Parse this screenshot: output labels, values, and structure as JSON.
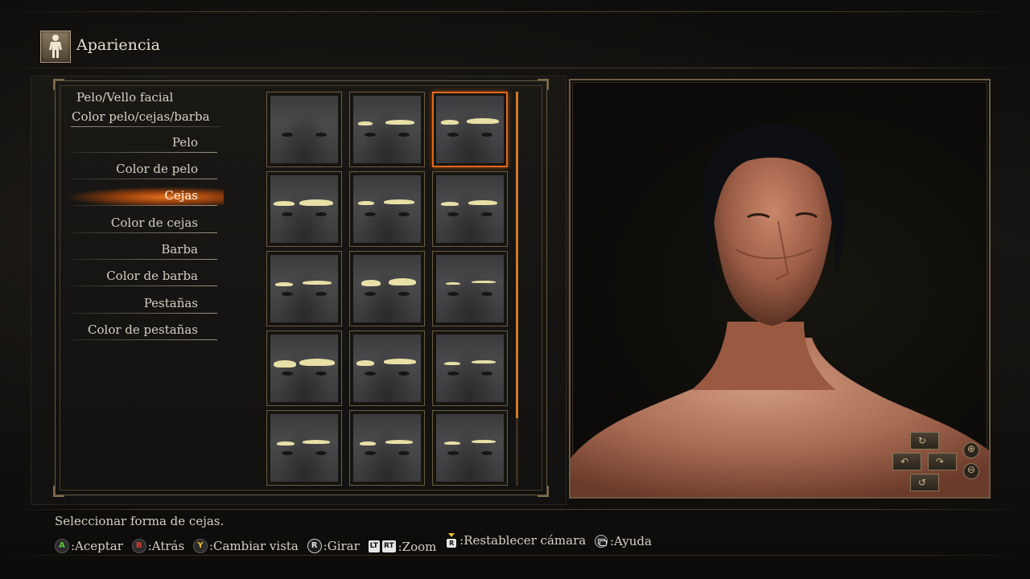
{
  "header": {
    "title": "Apariencia"
  },
  "menu": {
    "section_title": "Pelo/Vello facial",
    "section_subtitle": "Color pelo/cejas/barba",
    "items": [
      {
        "label": "Pelo"
      },
      {
        "label": "Color de pelo"
      },
      {
        "label": "Cejas",
        "active": true
      },
      {
        "label": "Color de cejas"
      },
      {
        "label": "Barba"
      },
      {
        "label": "Color de barba"
      },
      {
        "label": "Pestañas"
      },
      {
        "label": "Color de pestañas"
      }
    ]
  },
  "eyebrow_grid": {
    "selected_index": 2,
    "options_visible": 15,
    "columns": 3
  },
  "footer": {
    "help_text": "Seleccionar forma de cejas.",
    "controls": [
      {
        "button": "A",
        "label": ":Aceptar"
      },
      {
        "button": "B",
        "label": ":Atrás"
      },
      {
        "button": "Y",
        "label": ":Cambiar vista"
      },
      {
        "button": "R",
        "label": ":Girar"
      },
      {
        "button": "LT RT",
        "label": ":Zoom"
      },
      {
        "button": "R",
        "label": ":Restablecer cámara"
      },
      {
        "button": "view",
        "label": ":Ayuda"
      }
    ],
    "button_glyphs": {
      "lt": "LT",
      "rt": "RT",
      "r_stick": "R",
      "a": "A",
      "b": "B",
      "y": "Y"
    }
  },
  "colors": {
    "accent": "#e06a18",
    "frame": "#6e5c42",
    "text": "#d8d2c4",
    "brow": "#e8e0a6"
  }
}
